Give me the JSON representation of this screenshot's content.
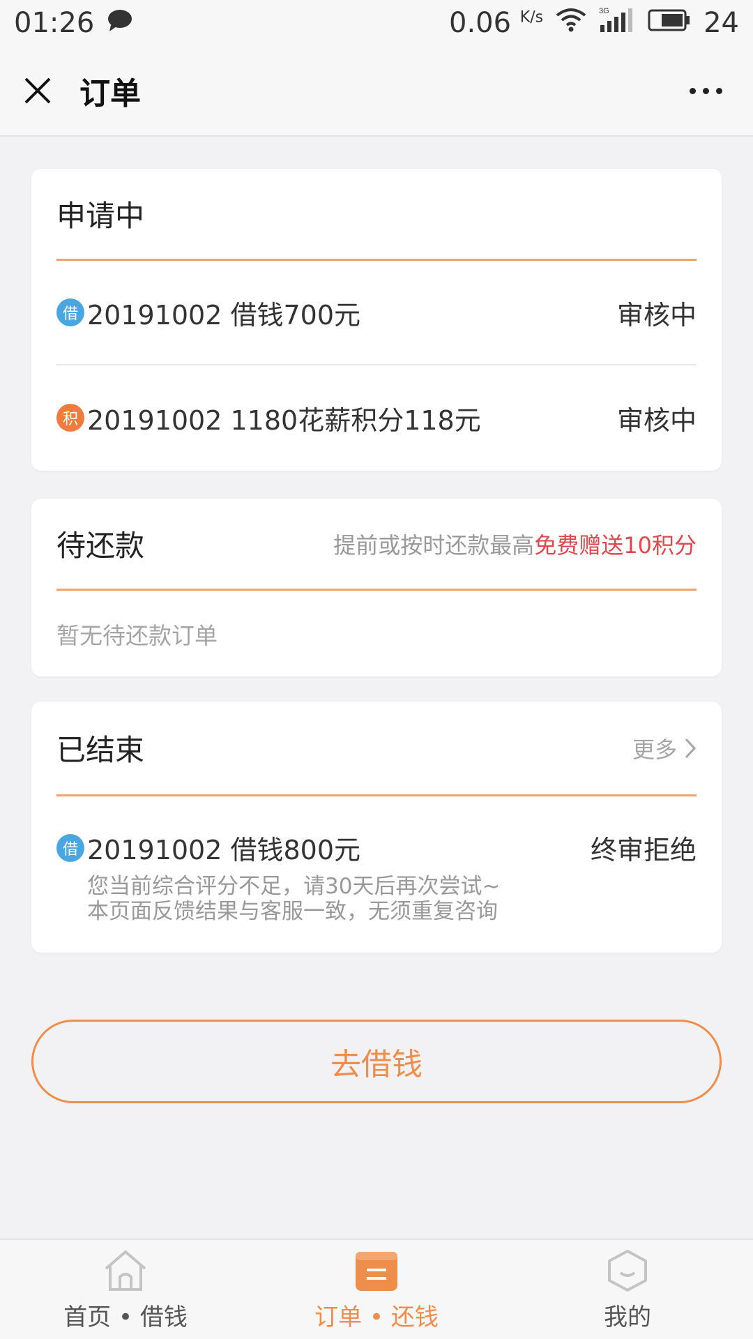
{
  "status_bar": {
    "time": "01:26",
    "speed": "0.06",
    "speed_unit": "K/s",
    "network": "3G",
    "battery": "24"
  },
  "header": {
    "title": "订单"
  },
  "applying": {
    "title": "申请中",
    "items": [
      {
        "badge": "借",
        "badge_color": "#4aa6e0",
        "text": "20191002 借钱700元",
        "status": "审核中"
      },
      {
        "badge": "积",
        "badge_color": "#f07b3f",
        "text": "20191002 1180花薪积分118元",
        "status": "审核中"
      }
    ]
  },
  "pending": {
    "title": "待还款",
    "promo_prefix": "提前或按时还款最高",
    "promo_highlight": "免费赠送10积分",
    "empty_text": "暂无待还款订单"
  },
  "ended": {
    "title": "已结束",
    "more_label": "更多",
    "item": {
      "badge": "借",
      "text": "20191002 借钱800元",
      "status": "终审拒绝",
      "note_line1": "您当前综合评分不足，请30天后再次尝试~",
      "note_line2": "本页面反馈结果与客服一致，无须重复咨询"
    }
  },
  "borrow_button": "去借钱",
  "bottom_nav": [
    {
      "label": "首页 • 借钱",
      "icon": "home-icon"
    },
    {
      "label": "订单 • 还钱",
      "icon": "orders-icon",
      "active": true
    },
    {
      "label": "我的",
      "icon": "profile-icon"
    }
  ],
  "colors": {
    "accent": "#ef8d4b",
    "highlight_red": "#e0474c",
    "badge_blue": "#4aa6e0",
    "badge_orange": "#f07b3f"
  }
}
